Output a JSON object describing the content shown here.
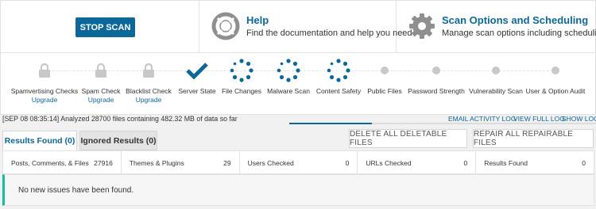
{
  "header": {
    "stop_scan_label": "STOP SCAN",
    "help": {
      "title": "Help",
      "description": "Find the documentation and help you need",
      "icon": "lifebuoy-icon"
    },
    "scan_options": {
      "title": "Scan Options and Scheduling",
      "description": "Manage scan options including scheduling",
      "icon": "gear-icon"
    }
  },
  "steps": [
    {
      "label": "Spamvertising Checks",
      "link": "Upgrade",
      "state": "locked"
    },
    {
      "label": "Spam Check",
      "link": "Upgrade",
      "state": "locked"
    },
    {
      "label": "Blacklist Check",
      "link": "Upgrade",
      "state": "locked"
    },
    {
      "label": "Server State",
      "state": "complete"
    },
    {
      "label": "File Changes",
      "state": "running"
    },
    {
      "label": "Malware Scan",
      "state": "running"
    },
    {
      "label": "Content Safety",
      "state": "running"
    },
    {
      "label": "Public Files",
      "state": "pending"
    },
    {
      "label": "Password Strength",
      "state": "pending"
    },
    {
      "label": "Vulnerability Scan",
      "state": "pending"
    },
    {
      "label": "User & Option Audit",
      "state": "pending"
    }
  ],
  "status": {
    "text": "[SEP 08 08:35:14] Analyzed 28700 files containing 482.32 MB of data so far",
    "links": {
      "email": "EMAIL ACTIVITY LOG",
      "full": "VIEW FULL LOG",
      "show": "SHOW LOG"
    },
    "progress": 0.27
  },
  "tabs": {
    "results_found": "Results Found (0)",
    "ignored_results": "Ignored Results (0)"
  },
  "actions": {
    "delete_all": "DELETE ALL DELETABLE FILES",
    "repair_all": "REPAIR ALL REPAIRABLE FILES"
  },
  "counts": [
    {
      "label": "Posts, Comments, & Files",
      "value": "27916"
    },
    {
      "label": "Themes & Plugins",
      "value": "29"
    },
    {
      "label": "Users Checked",
      "value": "0"
    },
    {
      "label": "URLs Checked",
      "value": "0"
    },
    {
      "label": "Results Found",
      "value": "0"
    }
  ],
  "result_message": "No new issues have been found.",
  "colors": {
    "accent": "#0b6898",
    "success": "#16bc9b",
    "pending": "#c8c8c8"
  }
}
